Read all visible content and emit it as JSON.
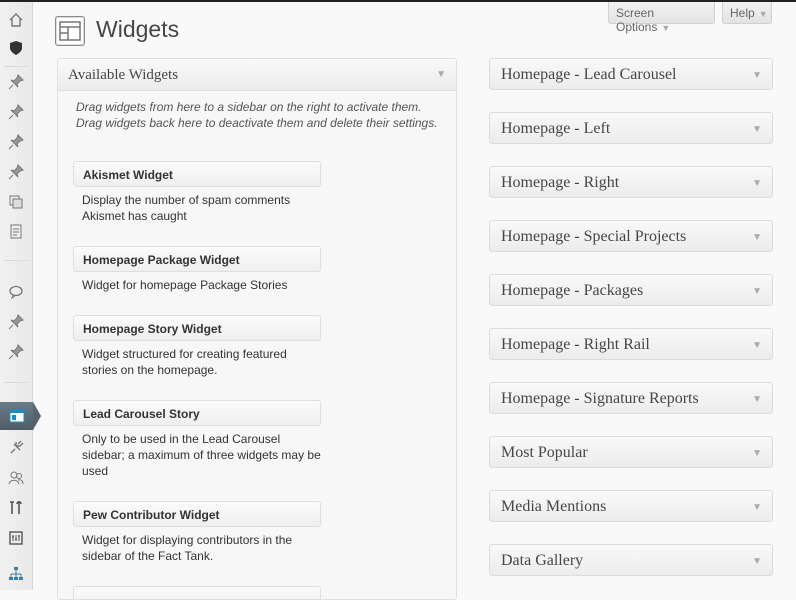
{
  "header": {
    "title": "Widgets",
    "screen_options": "Screen Options",
    "help": "Help"
  },
  "admin_menu": [
    {
      "icon": "home-icon"
    },
    {
      "icon": "shield-icon"
    },
    {
      "icon": "pin-icon"
    },
    {
      "icon": "pin-icon"
    },
    {
      "icon": "pin-icon"
    },
    {
      "icon": "pin-icon"
    },
    {
      "icon": "media-icon"
    },
    {
      "icon": "pages-icon"
    },
    {
      "icon": "comments-icon"
    },
    {
      "icon": "pin-icon"
    },
    {
      "icon": "pin-icon"
    },
    {
      "icon": "appearance-icon",
      "active": true
    },
    {
      "icon": "plugins-icon"
    },
    {
      "icon": "users-icon"
    },
    {
      "icon": "tools-icon"
    },
    {
      "icon": "settings-icon"
    },
    {
      "icon": "sitemap-icon"
    }
  ],
  "available": {
    "title": "Available Widgets",
    "description": "Drag widgets from here to a sidebar on the right to activate them. Drag widgets back here to deactivate them and delete their settings.",
    "widgets": [
      {
        "name": "Akismet Widget",
        "desc": "Display the number of spam comments Akismet has caught"
      },
      {
        "name": "Homepage Package Widget",
        "desc": "Widget for homepage Package Stories"
      },
      {
        "name": "Homepage Story Widget",
        "desc": "Widget structured for creating featured stories on the homepage."
      },
      {
        "name": "Lead Carousel Story",
        "desc": "Only to be used in the Lead Carousel sidebar; a maximum of three widgets may be used"
      },
      {
        "name": "Pew Contributor Widget",
        "desc": "Widget for displaying contributors in the sidebar of the Fact Tank."
      }
    ]
  },
  "sidebars": [
    "Homepage - Lead Carousel",
    "Homepage - Left",
    "Homepage - Right",
    "Homepage - Special Projects",
    "Homepage - Packages",
    "Homepage - Right Rail",
    "Homepage - Signature Reports",
    "Most Popular",
    "Media Mentions",
    "Data Gallery"
  ],
  "colors": {
    "active_menu": "#56636d",
    "panel_border": "#dfdfdf"
  }
}
